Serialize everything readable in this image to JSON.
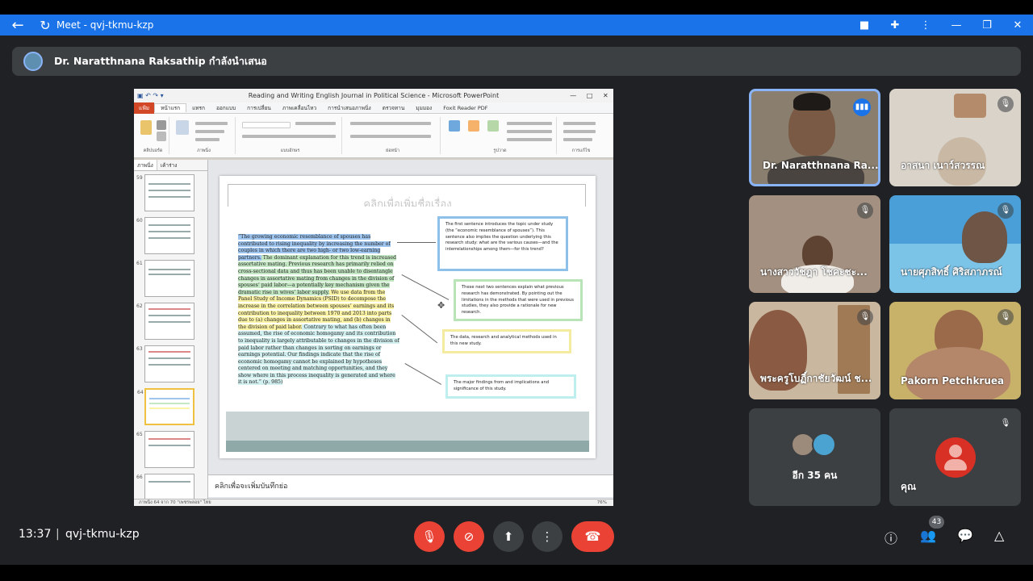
{
  "browser": {
    "title": "Meet - qvj-tkmu-kzp",
    "back_icon": "←",
    "reload_icon": "↻"
  },
  "banner": {
    "presenter_text": "Dr. Naratthnana Raksathip กำลังนำเสนอ"
  },
  "powerpoint": {
    "window_title": "Reading and Writing English Journal in Political Science  -  Microsoft PowerPoint",
    "tabs": [
      "แฟ้ม",
      "หน้าแรก",
      "แทรก",
      "ออกแบบ",
      "การเปลี่ยน",
      "ภาพเคลื่อนไหว",
      "การนำเสนอภาพนิ่ง",
      "ตรวจทาน",
      "มุมมอง",
      "Foxit Reader PDF"
    ],
    "ribbon_groups": [
      "คลิปบอร์ด",
      "ภาพนิ่ง",
      "แบบอักษร",
      "ย่อหน้า",
      "รูปวาด",
      "การแก้ไข"
    ],
    "panel_tabs": [
      "ภาพนิ่ง",
      "เค้าร่าง"
    ],
    "slide_title_placeholder": "คลิกเพื่อเพิ่มชื่อเรื่อง",
    "quote": {
      "part1": "“The growing economic resemblance of spouses has contributed to rising inequality by increasing the number of couples in which there are two high- or two low-earning partners.",
      "part2": " The dominant explanation for this trend is increased assortative mating. Previous research has primarily relied on cross-sectional data and thus has been unable to disentangle changes in assortative mating from changes in the division of spouses’ paid labor—a potentially key mechanism given the dramatic rise in wives’ labor supply.",
      "part3": " We use data from the Panel Study of Income Dynamics (PSID) to decompose the increase in the correlation between spouses’ earnings and its contribution to inequality between 1970 and 2013 into parts due to (a) changes in assortative mating, and (b) changes in the division of paid labor.",
      "part4": " Contrary to what has often been assumed, the rise of economic homogamy and its contribution to inequality is largely attributable to changes in the division of paid labor rather than changes in sorting on earnings or earnings potential. Our findings indicate that the rise of economic homogamy cannot be explained by hypotheses centered on meeting and matching opportunities, and they show where in this process inequality is generated and where it is not.” (p. 985)"
    },
    "callouts": {
      "c1": "The first sentence introduces the topic under study (the “economic resemblance of spouses”). This sentence also implies the question underlying this research study: what are the various causes—and the interrelationships among them—for this trend?",
      "c2": "These next two sentences explain what previous research has demonstrated. By pointing out the limitations in the methods that were used in previous studies, they also provide a rationale for new research.",
      "c3": "The data, research and analytical methods used in this new study.",
      "c4": "The major findings from and implications and significance of this study."
    },
    "notes_placeholder": "คลิกเพื่อจะเพิ่มบันทึกย่อ",
    "status_left": "ภาพนิ่ง 64 จาก 70   \"เพชรพลอย\"   ไทย",
    "status_zoom": "76%",
    "thumb_numbers": [
      "59",
      "60",
      "61",
      "62",
      "63",
      "64",
      "65",
      "66"
    ]
  },
  "participants": [
    {
      "name": "Dr. Naratthnana Ra...",
      "mic": "speaking"
    },
    {
      "name": "อาสนา เนาว์สวรรณ",
      "mic": "muted"
    },
    {
      "name": "นางสาววัชฎา โชคะชะ...",
      "mic": "muted"
    },
    {
      "name": "นายศุภสิทธิ์ ศิริสภาภรณ์",
      "mic": "muted"
    },
    {
      "name": "พระครูโบฏิ์กาชัยวัฒน์ ช...",
      "mic": "muted"
    },
    {
      "name": "Pakorn Petchkruea",
      "mic": "muted"
    }
  ],
  "others_tile": {
    "label": "อีก 35 คน"
  },
  "self_tile": {
    "label": "คุณ"
  },
  "bottom": {
    "time": "13:37",
    "separator": "|",
    "meeting_code": "qvj-tkmu-kzp",
    "participants_count": "43",
    "mic_off_icon": "🎙",
    "cam_off_icon": "⊘",
    "present_icon": "⬆",
    "more_icon": "⋮",
    "hangup_icon": "☎",
    "info_icon": "ⓘ",
    "people_icon": "👥",
    "chat_icon": "💬",
    "activities_icon": "△"
  },
  "colors": {
    "meet_blue": "#1a73e8",
    "danger_red": "#ea4335",
    "stage_bg": "#202124"
  }
}
